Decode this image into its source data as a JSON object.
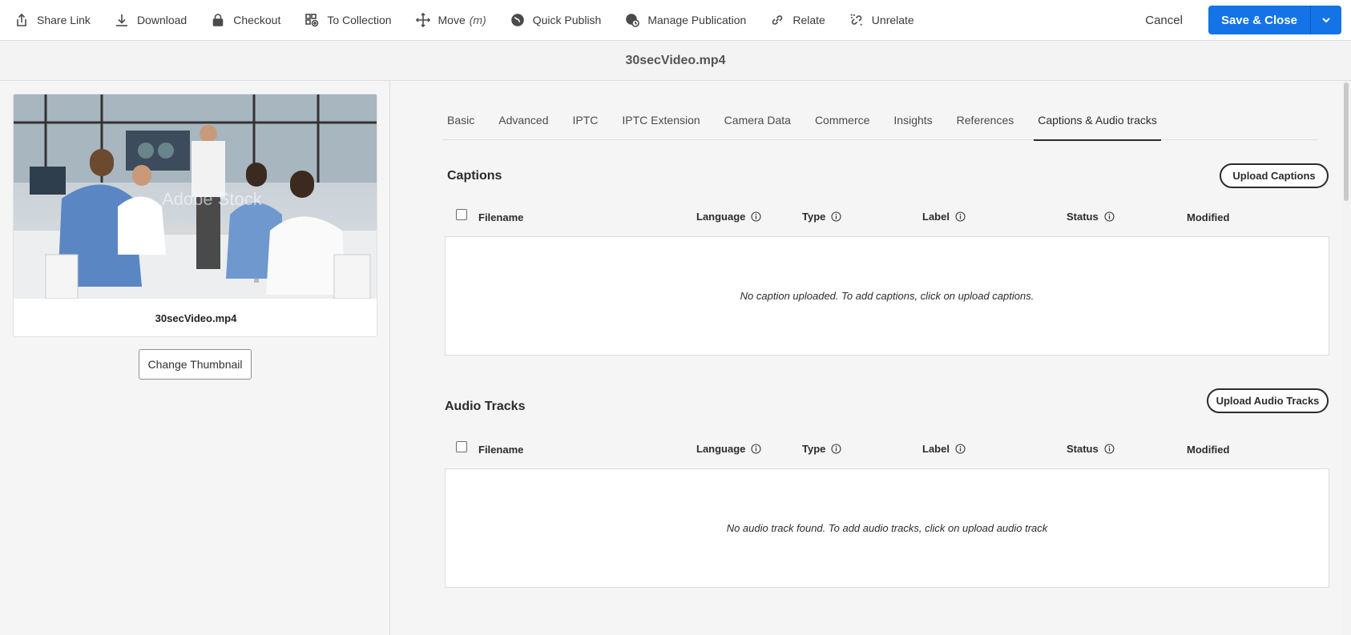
{
  "toolbar": {
    "items": [
      {
        "label": "Share Link",
        "icon": "share-icon"
      },
      {
        "label": "Download",
        "icon": "download-icon"
      },
      {
        "label": "Checkout",
        "icon": "lock-icon"
      },
      {
        "label": "To Collection",
        "icon": "collection-add-icon"
      },
      {
        "label": "Move",
        "hint": "(m)",
        "icon": "move-icon"
      },
      {
        "label": "Quick Publish",
        "icon": "globe-icon"
      },
      {
        "label": "Manage Publication",
        "icon": "globe-clock-icon"
      },
      {
        "label": "Relate",
        "icon": "link-icon"
      },
      {
        "label": "Unrelate",
        "icon": "unlink-icon"
      }
    ],
    "cancel_label": "Cancel",
    "save_label": "Save & Close"
  },
  "page": {
    "title": "30secVideo.mp4"
  },
  "asset": {
    "filename": "30secVideo.mp4",
    "watermark": "Adobe Stock",
    "change_thumbnail_label": "Change Thumbnail"
  },
  "tabs": [
    {
      "label": "Basic"
    },
    {
      "label": "Advanced"
    },
    {
      "label": "IPTC"
    },
    {
      "label": "IPTC Extension"
    },
    {
      "label": "Camera Data"
    },
    {
      "label": "Commerce"
    },
    {
      "label": "Insights"
    },
    {
      "label": "References"
    },
    {
      "label": "Captions & Audio tracks",
      "active": true
    }
  ],
  "captions": {
    "title": "Captions",
    "upload_label": "Upload Captions",
    "columns": [
      "Filename",
      "Language",
      "Type",
      "Label",
      "Status",
      "Modified"
    ],
    "empty_message": "No caption uploaded. To add captions, click on upload captions."
  },
  "audio": {
    "title": "Audio Tracks",
    "upload_label": "Upload Audio Tracks",
    "columns": [
      "Filename",
      "Language",
      "Type",
      "Label",
      "Status",
      "Modified"
    ],
    "empty_message": "No audio track found. To add audio tracks, click on upload audio track"
  },
  "colors": {
    "accent": "#1473e6",
    "text": "#2c2c2c",
    "border": "#dcdcdc"
  }
}
